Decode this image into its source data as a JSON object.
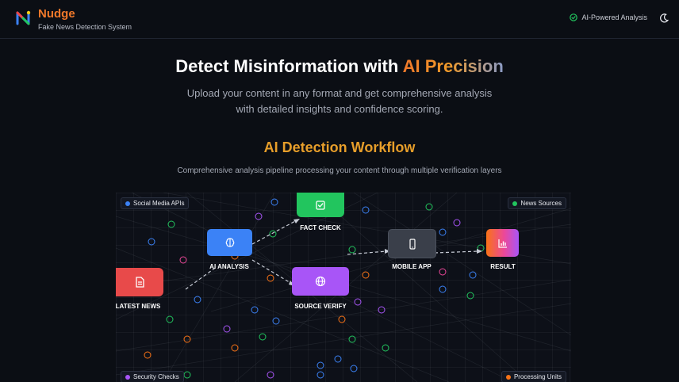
{
  "header": {
    "brand_name": "Nudge",
    "brand_subtitle": "Fake News Detection System",
    "status_label": "AI-Powered Analysis"
  },
  "hero": {
    "title_prefix": "Detect Misinformation with ",
    "title_accent": "AI Precision",
    "subtitle": "Upload your content in any format and get comprehensive analysis with detailed insights and confidence scoring."
  },
  "workflow": {
    "title": "AI Detection Workflow",
    "subtitle": "Comprehensive analysis pipeline processing your content through multiple verification layers",
    "corner_labels": {
      "social_media": "Social Media APIs",
      "news_sources": "News Sources",
      "security_checks": "Security Checks",
      "processing_units": "Processing Units"
    },
    "nodes": {
      "latest_news": "LATEST NEWS",
      "ai_analysis": "AI ANALYSIS",
      "fact_check": "FACT CHECK",
      "source_verify": "SOURCE VERIFY",
      "mobile_app": "MOBILE APP",
      "result": "RESULT"
    }
  },
  "colors": {
    "brand_orange": "#f0782a",
    "latest_news": "#e84a4a",
    "ai_analysis": "#3b82f6",
    "fact_check": "#22c55e",
    "source_verify": "#a855f7",
    "mobile_app": "#3a3f4a",
    "dot_blue": "#3b82f6",
    "dot_green": "#22c55e",
    "dot_purple": "#a855f7",
    "dot_orange": "#f97316"
  }
}
